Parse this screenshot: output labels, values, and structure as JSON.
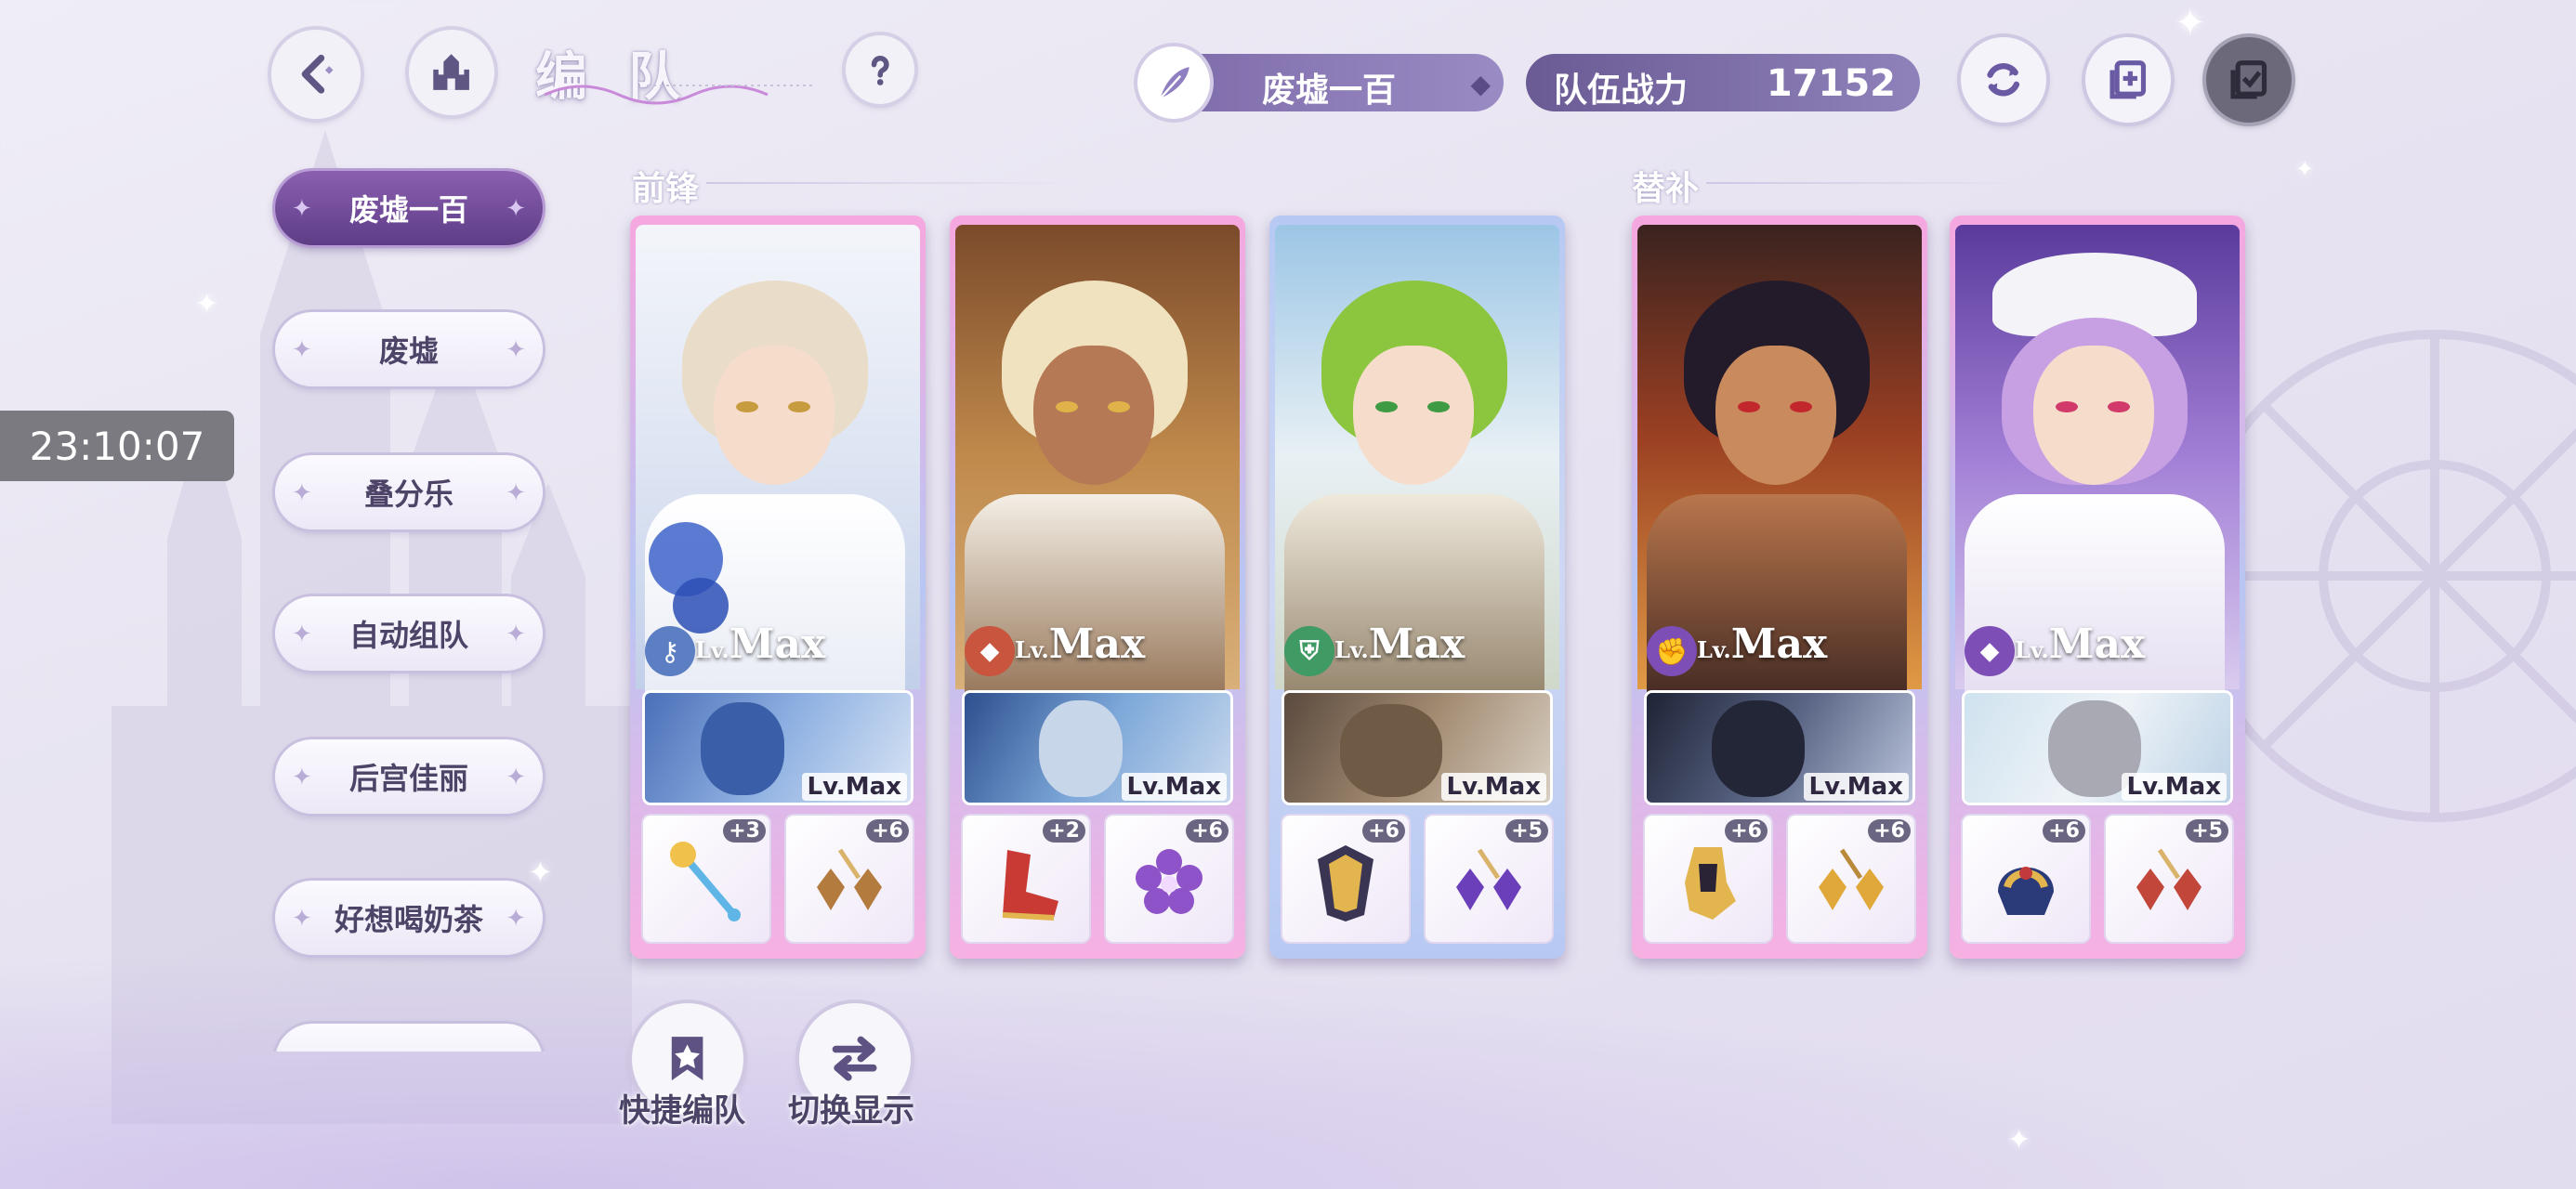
{
  "header": {
    "title": "编队",
    "team_name": "废墟一百",
    "power_label": "队伍战力",
    "power_value": "17152"
  },
  "clock": "23:10:07",
  "sidebar": {
    "items": [
      {
        "label": "废墟一百",
        "active": true
      },
      {
        "label": "废墟",
        "active": false
      },
      {
        "label": "叠分乐",
        "active": false
      },
      {
        "label": "自动组队",
        "active": false
      },
      {
        "label": "后宫佳丽",
        "active": false
      },
      {
        "label": "好想喝奶茶",
        "active": false
      }
    ]
  },
  "sections": {
    "front": "前锋",
    "sub": "替补"
  },
  "cards": [
    {
      "level_prefix": "Lv.",
      "level": "Max",
      "partner_level": "Lv.Max",
      "class": "key-icon",
      "class_color": "#5c7fc4",
      "gear": [
        {
          "bonus": "+3",
          "icon": "scepter-icon"
        },
        {
          "bonus": "+6",
          "icon": "earring-icon"
        }
      ]
    },
    {
      "level_prefix": "Lv.",
      "level": "Max",
      "partner_level": "Lv.Max",
      "class": "boot-icon",
      "class_color": "#c9553e",
      "gear": [
        {
          "bonus": "+2",
          "icon": "shoe-icon"
        },
        {
          "bonus": "+6",
          "icon": "flower-icon"
        }
      ]
    },
    {
      "level_prefix": "Lv.",
      "level": "Max",
      "partner_level": "Lv.Max",
      "class": "shield-icon",
      "class_color": "#3f9a64",
      "gear": [
        {
          "bonus": "+6",
          "icon": "armor-icon"
        },
        {
          "bonus": "+5",
          "icon": "earring-icon"
        }
      ]
    },
    {
      "level_prefix": "Lv.",
      "level": "Max",
      "partner_level": "Lv.Max",
      "class": "fist-icon",
      "class_color": "#7d4fb6",
      "gear": [
        {
          "bonus": "+6",
          "icon": "gauntlet-icon"
        },
        {
          "bonus": "+6",
          "icon": "earring-icon"
        }
      ]
    },
    {
      "level_prefix": "Lv.",
      "level": "Max",
      "partner_level": "Lv.Max",
      "class": "boot-icon",
      "class_color": "#7d4fb6",
      "gear": [
        {
          "bonus": "+6",
          "icon": "helmet-icon"
        },
        {
          "bonus": "+5",
          "icon": "earring-icon"
        }
      ]
    }
  ],
  "bottom": {
    "quick_label": "快捷编队",
    "switch_label": "切换显示"
  }
}
